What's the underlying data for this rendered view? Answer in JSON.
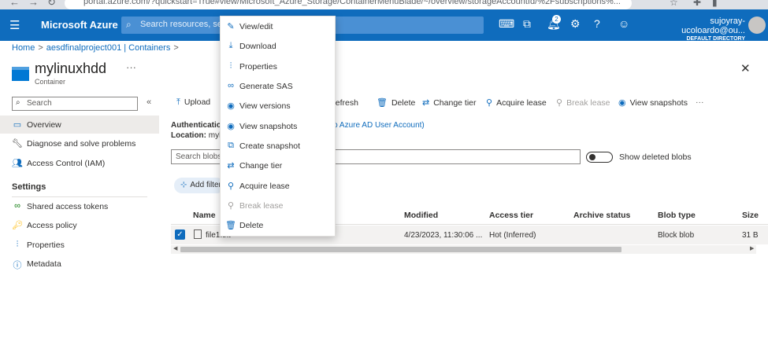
{
  "browser": {
    "address": "portal.azure.com/?quickstart=True#view/Microsoft_Azure_Storage/ContainerMenuBlade/~/overview/storageAccountId/%2Fsubscriptions%..."
  },
  "topbar": {
    "brand": "Microsoft Azure",
    "search_placeholder": "Search resources, services, and docs (G+/)",
    "notifications_count": "2",
    "user_name": "sujoyray-ucoloardo@ou...",
    "directory": "DEFAULT DIRECTORY"
  },
  "breadcrumb": {
    "home": "Home",
    "sep": ">",
    "item": "aesdfinalproject001 | Containers"
  },
  "page": {
    "title": "mylinuxhdd",
    "subtitle": "Container",
    "more": "···"
  },
  "sidebar": {
    "search_placeholder": "Search",
    "items": [
      {
        "label": "Overview"
      },
      {
        "label": "Diagnose and solve problems"
      },
      {
        "label": "Access Control (IAM)"
      }
    ],
    "settings_heading": "Settings",
    "settings_items": [
      {
        "label": "Shared access tokens"
      },
      {
        "label": "Access policy"
      },
      {
        "label": "Properties"
      },
      {
        "label": "Metadata"
      }
    ]
  },
  "toolbar": {
    "upload": "Upload",
    "refresh": "Refresh",
    "delete": "Delete",
    "change_tier": "Change tier",
    "acquire_lease": "Acquire lease",
    "break_lease": "Break lease",
    "view_snapshots": "View snapshots",
    "more": "···"
  },
  "info": {
    "auth_label": "Authentication method:",
    "auth_value": "Access key (Switch to Azure AD User Account)",
    "location_label": "Location:",
    "location_value": "mylinuxhdd"
  },
  "filters": {
    "search_placeholder": "Search blobs by prefix (case-sensitive)",
    "show_deleted": "Show deleted blobs",
    "add_filter": "Add filter"
  },
  "table": {
    "columns": [
      "Name",
      "Modified",
      "Access tier",
      "Archive status",
      "Blob type",
      "Size"
    ],
    "rows": [
      {
        "name": "file1.txt",
        "modified": "4/23/2023, 11:30:06 ...",
        "access_tier": "Hot (Inferred)",
        "archive_status": "",
        "blob_type": "Block blob",
        "size": "31 B"
      }
    ]
  },
  "context_menu": {
    "items": [
      {
        "label": "View/edit",
        "icon": "pencil-icon",
        "enabled": true
      },
      {
        "label": "Download",
        "icon": "download-icon",
        "enabled": true
      },
      {
        "label": "Properties",
        "icon": "properties-icon",
        "enabled": true
      },
      {
        "label": "Generate SAS",
        "icon": "link-icon",
        "enabled": true
      },
      {
        "label": "View versions",
        "icon": "eye-icon",
        "enabled": true
      },
      {
        "label": "View snapshots",
        "icon": "eye-icon",
        "enabled": true
      },
      {
        "label": "Create snapshot",
        "icon": "snapshot-icon",
        "enabled": true
      },
      {
        "label": "Change tier",
        "icon": "swap-icon",
        "enabled": true
      },
      {
        "label": "Acquire lease",
        "icon": "lease-icon",
        "enabled": true
      },
      {
        "label": "Break lease",
        "icon": "break-lease-icon",
        "enabled": false
      },
      {
        "label": "Delete",
        "icon": "trash-icon",
        "enabled": true
      }
    ]
  },
  "colors": {
    "accent": "#0f6cbd",
    "topbar": "#0f6cbd",
    "disabled": "#a19f9d"
  }
}
